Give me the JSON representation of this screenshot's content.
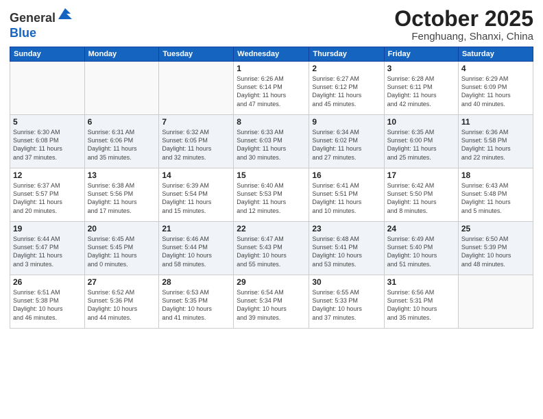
{
  "logo": {
    "general": "General",
    "blue": "Blue"
  },
  "title": "October 2025",
  "subtitle": "Fenghuang, Shanxi, China",
  "weekdays": [
    "Sunday",
    "Monday",
    "Tuesday",
    "Wednesday",
    "Thursday",
    "Friday",
    "Saturday"
  ],
  "weeks": [
    [
      {
        "day": "",
        "info": ""
      },
      {
        "day": "",
        "info": ""
      },
      {
        "day": "",
        "info": ""
      },
      {
        "day": "1",
        "info": "Sunrise: 6:26 AM\nSunset: 6:14 PM\nDaylight: 11 hours\nand 47 minutes."
      },
      {
        "day": "2",
        "info": "Sunrise: 6:27 AM\nSunset: 6:12 PM\nDaylight: 11 hours\nand 45 minutes."
      },
      {
        "day": "3",
        "info": "Sunrise: 6:28 AM\nSunset: 6:11 PM\nDaylight: 11 hours\nand 42 minutes."
      },
      {
        "day": "4",
        "info": "Sunrise: 6:29 AM\nSunset: 6:09 PM\nDaylight: 11 hours\nand 40 minutes."
      }
    ],
    [
      {
        "day": "5",
        "info": "Sunrise: 6:30 AM\nSunset: 6:08 PM\nDaylight: 11 hours\nand 37 minutes."
      },
      {
        "day": "6",
        "info": "Sunrise: 6:31 AM\nSunset: 6:06 PM\nDaylight: 11 hours\nand 35 minutes."
      },
      {
        "day": "7",
        "info": "Sunrise: 6:32 AM\nSunset: 6:05 PM\nDaylight: 11 hours\nand 32 minutes."
      },
      {
        "day": "8",
        "info": "Sunrise: 6:33 AM\nSunset: 6:03 PM\nDaylight: 11 hours\nand 30 minutes."
      },
      {
        "day": "9",
        "info": "Sunrise: 6:34 AM\nSunset: 6:02 PM\nDaylight: 11 hours\nand 27 minutes."
      },
      {
        "day": "10",
        "info": "Sunrise: 6:35 AM\nSunset: 6:00 PM\nDaylight: 11 hours\nand 25 minutes."
      },
      {
        "day": "11",
        "info": "Sunrise: 6:36 AM\nSunset: 5:58 PM\nDaylight: 11 hours\nand 22 minutes."
      }
    ],
    [
      {
        "day": "12",
        "info": "Sunrise: 6:37 AM\nSunset: 5:57 PM\nDaylight: 11 hours\nand 20 minutes."
      },
      {
        "day": "13",
        "info": "Sunrise: 6:38 AM\nSunset: 5:56 PM\nDaylight: 11 hours\nand 17 minutes."
      },
      {
        "day": "14",
        "info": "Sunrise: 6:39 AM\nSunset: 5:54 PM\nDaylight: 11 hours\nand 15 minutes."
      },
      {
        "day": "15",
        "info": "Sunrise: 6:40 AM\nSunset: 5:53 PM\nDaylight: 11 hours\nand 12 minutes."
      },
      {
        "day": "16",
        "info": "Sunrise: 6:41 AM\nSunset: 5:51 PM\nDaylight: 11 hours\nand 10 minutes."
      },
      {
        "day": "17",
        "info": "Sunrise: 6:42 AM\nSunset: 5:50 PM\nDaylight: 11 hours\nand 8 minutes."
      },
      {
        "day": "18",
        "info": "Sunrise: 6:43 AM\nSunset: 5:48 PM\nDaylight: 11 hours\nand 5 minutes."
      }
    ],
    [
      {
        "day": "19",
        "info": "Sunrise: 6:44 AM\nSunset: 5:47 PM\nDaylight: 11 hours\nand 3 minutes."
      },
      {
        "day": "20",
        "info": "Sunrise: 6:45 AM\nSunset: 5:45 PM\nDaylight: 11 hours\nand 0 minutes."
      },
      {
        "day": "21",
        "info": "Sunrise: 6:46 AM\nSunset: 5:44 PM\nDaylight: 10 hours\nand 58 minutes."
      },
      {
        "day": "22",
        "info": "Sunrise: 6:47 AM\nSunset: 5:43 PM\nDaylight: 10 hours\nand 55 minutes."
      },
      {
        "day": "23",
        "info": "Sunrise: 6:48 AM\nSunset: 5:41 PM\nDaylight: 10 hours\nand 53 minutes."
      },
      {
        "day": "24",
        "info": "Sunrise: 6:49 AM\nSunset: 5:40 PM\nDaylight: 10 hours\nand 51 minutes."
      },
      {
        "day": "25",
        "info": "Sunrise: 6:50 AM\nSunset: 5:39 PM\nDaylight: 10 hours\nand 48 minutes."
      }
    ],
    [
      {
        "day": "26",
        "info": "Sunrise: 6:51 AM\nSunset: 5:38 PM\nDaylight: 10 hours\nand 46 minutes."
      },
      {
        "day": "27",
        "info": "Sunrise: 6:52 AM\nSunset: 5:36 PM\nDaylight: 10 hours\nand 44 minutes."
      },
      {
        "day": "28",
        "info": "Sunrise: 6:53 AM\nSunset: 5:35 PM\nDaylight: 10 hours\nand 41 minutes."
      },
      {
        "day": "29",
        "info": "Sunrise: 6:54 AM\nSunset: 5:34 PM\nDaylight: 10 hours\nand 39 minutes."
      },
      {
        "day": "30",
        "info": "Sunrise: 6:55 AM\nSunset: 5:33 PM\nDaylight: 10 hours\nand 37 minutes."
      },
      {
        "day": "31",
        "info": "Sunrise: 6:56 AM\nSunset: 5:31 PM\nDaylight: 10 hours\nand 35 minutes."
      },
      {
        "day": "",
        "info": ""
      }
    ]
  ]
}
